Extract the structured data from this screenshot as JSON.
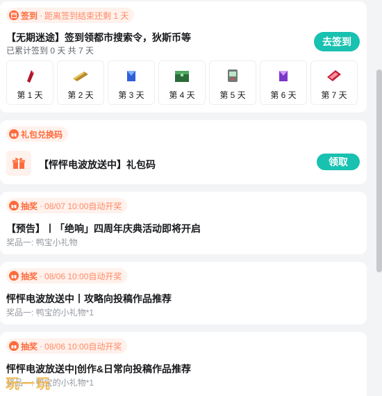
{
  "checkin": {
    "tag_label": "签到",
    "tag_desc": "距离签到结束还剩 1 天",
    "title": "【无期迷途】签到领都市搜索令，狄斯币等",
    "progress": "已累计签到 0 天  共 7 天",
    "button_label": "去签到",
    "days": [
      {
        "label": "第 1 天",
        "icon": "red-crystal-icon"
      },
      {
        "label": "第 2 天",
        "icon": "gold-bar-icon"
      },
      {
        "label": "第 3 天",
        "icon": "blue-card-icon"
      },
      {
        "label": "第 4 天",
        "icon": "green-chest-icon"
      },
      {
        "label": "第 5 天",
        "icon": "device-icon"
      },
      {
        "label": "第 6 天",
        "icon": "purple-card-icon"
      },
      {
        "label": "第 7 天",
        "icon": "red-ticket-icon"
      }
    ]
  },
  "giftcode": {
    "tag_label": "礼包兑换码",
    "title": "【怦怦电波放送中】礼包码",
    "button_label": "领取"
  },
  "lotteries": [
    {
      "tag_label": "抽奖",
      "tag_desc": "08/07 10:00自动开奖",
      "title": "【预告】丨「绝响」四周年庆典活动即将开启",
      "prize": "奖品一: 鸭宝小礼物"
    },
    {
      "tag_label": "抽奖",
      "tag_desc": "08/06 10:00自动开奖",
      "title": "怦怦电波放送中丨攻略向投稿作品推荐",
      "prize": "奖品一: 鸭宝的小礼物*1"
    },
    {
      "tag_label": "抽奖",
      "tag_desc": "08/06 10:00自动开奖",
      "title": "怦怦电波放送中|创作&日常向投稿作品推荐",
      "prize": "奖品一: 鸭宝的小礼物*1"
    }
  ],
  "watermark": "玩一玩",
  "colors": {
    "accent": "#18c1b0",
    "tag": "#ff6b3d",
    "tag_bg": "#fff1ec"
  }
}
